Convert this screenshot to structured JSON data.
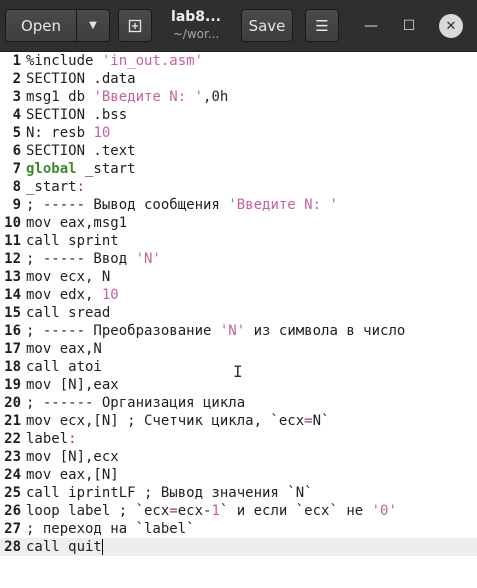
{
  "header": {
    "open_label": "Open",
    "title": "lab8...",
    "subtitle": "~/wor...",
    "save_label": "Save"
  },
  "icons": {
    "open_menu": "chevron-down-icon",
    "new_tab": "new-document-icon",
    "menu": "hamburger-menu-icon",
    "minimize": "minimize-icon",
    "maximize": "maximize-icon",
    "close": "close-icon",
    "cursor": "text-cursor-icon"
  },
  "glyphs": {
    "chevron": "▼",
    "menu": "☰",
    "minimize": "—",
    "maximize": "☐",
    "close": "✕",
    "ibeam": "I"
  },
  "current_line": 28,
  "lines": [
    [
      [
        "",
        "%include "
      ],
      [
        "str",
        "'in_out.asm'"
      ]
    ],
    [
      [
        "",
        "SECTION .data"
      ]
    ],
    [
      [
        "",
        "msg1 db "
      ],
      [
        "str",
        "'Введите N: '"
      ],
      [
        "",
        ",0h"
      ]
    ],
    [
      [
        "",
        "SECTION .bss"
      ]
    ],
    [
      [
        "",
        "N: resb "
      ],
      [
        "num",
        "10"
      ]
    ],
    [
      [
        "",
        "SECTION .text"
      ]
    ],
    [
      [
        "kw",
        "global"
      ],
      [
        "",
        " _start"
      ]
    ],
    [
      [
        "",
        "_start"
      ],
      [
        "lbl",
        ":"
      ]
    ],
    [
      [
        "",
        "; ----- Вывод сообщения "
      ],
      [
        "str",
        "'Введите N: '"
      ]
    ],
    [
      [
        "",
        "mov eax,msg1"
      ]
    ],
    [
      [
        "",
        "call sprint"
      ]
    ],
    [
      [
        "",
        "; ----- Ввод "
      ],
      [
        "str",
        "'N'"
      ]
    ],
    [
      [
        "",
        "mov ecx, N"
      ]
    ],
    [
      [
        "",
        "mov edx, "
      ],
      [
        "num",
        "10"
      ]
    ],
    [
      [
        "",
        "call sread"
      ]
    ],
    [
      [
        "",
        "; ----- Преобразование "
      ],
      [
        "str",
        "'N'"
      ],
      [
        "",
        " из символа в число"
      ]
    ],
    [
      [
        "",
        "mov eax,N"
      ]
    ],
    [
      [
        "",
        "call atoi"
      ]
    ],
    [
      [
        "",
        "mov [N],eax"
      ]
    ],
    [
      [
        "",
        "; ------ Организация цикла"
      ]
    ],
    [
      [
        "",
        "mov ecx,[N] ; Счетчик цикла, `ecx"
      ],
      [
        "lbl",
        "="
      ],
      [
        "",
        "N`"
      ]
    ],
    [
      [
        "",
        "label"
      ],
      [
        "lbl",
        ":"
      ]
    ],
    [
      [
        "",
        "mov [N],ecx"
      ]
    ],
    [
      [
        "",
        "mov eax,[N]"
      ]
    ],
    [
      [
        "",
        "call iprintLF ; Вывод значения `N`"
      ]
    ],
    [
      [
        "",
        "loop label ; `ecx"
      ],
      [
        "lbl",
        "="
      ],
      [
        "",
        "ecx-"
      ],
      [
        "num",
        "1"
      ],
      [
        "",
        "` и если `ecx` не "
      ],
      [
        "str",
        "'0'"
      ]
    ],
    [
      [
        "",
        "; переход на `label`"
      ]
    ],
    [
      [
        "",
        "call quit"
      ]
    ]
  ]
}
